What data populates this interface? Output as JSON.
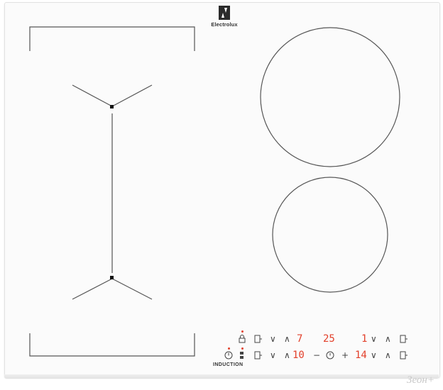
{
  "brand": {
    "name": "Electrolux"
  },
  "panel": {
    "label": "INDUCTION",
    "row1": {
      "left_digit": "7",
      "timer_display": "25",
      "right_digit": "1"
    },
    "row2": {
      "left_digit": "10",
      "minus": "−",
      "plus": "+",
      "right_digit": "14"
    },
    "chevron_down": "∨",
    "chevron_up": "∧"
  },
  "watermark": "Зеон+",
  "colors": {
    "display": "#e2402b",
    "line": "#444444",
    "surface": "#fbfbfb"
  }
}
